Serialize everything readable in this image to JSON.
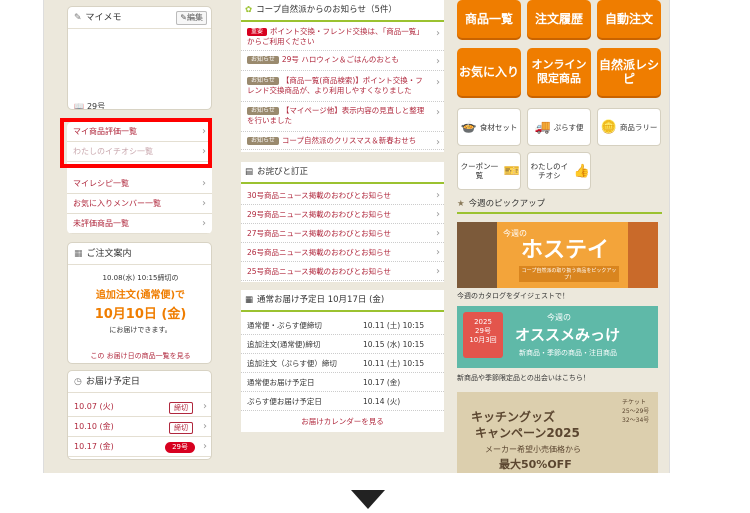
{
  "left": {
    "memo": {
      "title": "マイメモ",
      "edit": "編集",
      "num": "29号"
    },
    "links": [
      "マイ商品評価一覧",
      "わたしのイチオシ一覧",
      "マイレシピ一覧",
      "お気に入りメンバー一覧",
      "未評価商品一覧"
    ],
    "order": {
      "title": "ご注文案内",
      "line1": "10.08(水) 10:15締切の",
      "line2": "追加注文(通常便)で",
      "line3": "10月10日 (金)",
      "line4": "にお届けできます。",
      "link": "この お届け日の商品一覧を見る"
    },
    "schedule": {
      "title": "お届け予定日",
      "rows": [
        {
          "date": "10.07 (火)",
          "badge": "締切"
        },
        {
          "date": "10.10 (金)",
          "badge": "締切"
        },
        {
          "date": "10.17 (金)",
          "badge": "29号"
        }
      ]
    }
  },
  "center": {
    "news": {
      "title": "コープ自然派からのお知らせ（5件）",
      "items": [
        {
          "tag": "重要",
          "text": "ポイント交換・フレンド交換は、「商品一覧」からご利用ください"
        },
        {
          "tag": "お知らせ",
          "text": "29号 ハロウィン＆ごはんのおとも"
        },
        {
          "tag": "お知らせ",
          "text": "【商品一覧(商品検索)】ポイント交換・フレンド交換商品が、より利用しやすくなりました"
        },
        {
          "tag": "お知らせ",
          "text": "【マイページ他】表示内容の見直しと整理を行いました"
        },
        {
          "tag": "お知らせ",
          "text": "コープ自然派のクリスマス＆新春おせち"
        }
      ]
    },
    "apology": {
      "title": "お詫びと訂正",
      "items": [
        "30号商品ニュース掲載のおわびとお知らせ",
        "29号商品ニュース掲載のおわびとお知らせ",
        "27号商品ニュース掲載のおわびとお知らせ",
        "26号商品ニュース掲載のおわびとお知らせ",
        "25号商品ニュース掲載のおわびとお知らせ"
      ]
    },
    "delivery": {
      "title": "通常お届け予定日 10月17日 (金)",
      "rows": [
        {
          "label": "通常便・ぷらす便締切",
          "date": "10.11 (土) 10:15"
        },
        {
          "label": "追加注文(通常便)締切",
          "date": "10.15 (水) 10:15"
        },
        {
          "label": "追加注文（ぷらす便）締切",
          "date": "10.11 (土) 10:15"
        },
        {
          "label": "通常便お届け予定日",
          "date": "10.17 (金)"
        },
        {
          "label": "ぷらす便お届け予定日",
          "date": "10.14 (火)"
        }
      ],
      "link": "お届けカレンダーを見る"
    }
  },
  "right": {
    "buttons": [
      "商品一覧",
      "注文履歴",
      "自動注文",
      "お気に入り",
      "オンライン限定商品",
      "自然派レシピ"
    ],
    "buttons2": [
      {
        "label": "食材セット",
        "icon": "food-set-icon"
      },
      {
        "label": "ぷらす便",
        "icon": "truck-icon"
      },
      {
        "label": "商品ラリー",
        "icon": "coins-icon"
      },
      {
        "label": "クーポン一覧",
        "icon": "coupon-icon"
      },
      {
        "label": "わたしのイチオシ",
        "icon": "thumbs-up-icon"
      }
    ],
    "pickup": {
      "title": "今週のピックアップ",
      "banner1": {
        "label": "今週の",
        "title": "ホステイ",
        "sub": "コープ自然派の取り扱う商品をピックアップ！"
      },
      "caption1": "今週のカタログをダイジェストで！",
      "banner2": {
        "issue": "2025",
        "num": "29号",
        "week": "10月3回",
        "label": "今週の",
        "title": "オススメみっけ",
        "sub": "新商品・季節の商品・注目商品"
      },
      "caption2": "新商品や季節限定品との出会いはこちら！",
      "banner3": {
        "title": "キッチングッズ",
        "title2": "キャンペーン2025",
        "sub": "メーカー希望小売価格から",
        "off": "最大50%OFF",
        "side1": "チケット",
        "side2": "25〜29号",
        "side3": "32〜34号"
      }
    }
  }
}
